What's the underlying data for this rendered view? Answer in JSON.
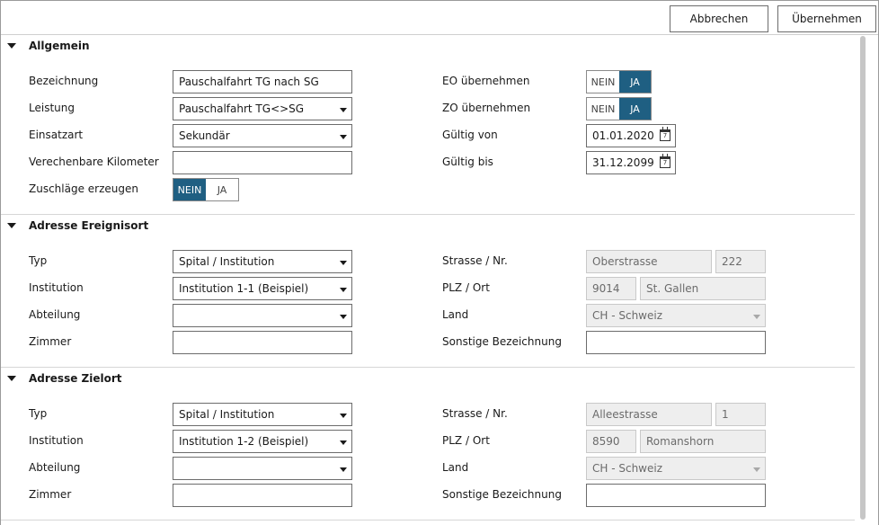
{
  "buttons": {
    "cancel": "Abbrechen",
    "apply": "Übernehmen"
  },
  "sections": {
    "general": {
      "title": "Allgemein",
      "bezeichnung_label": "Bezeichnung",
      "bezeichnung_value": "Pauschalfahrt TG nach SG",
      "leistung_label": "Leistung",
      "leistung_value": "Pauschalfahrt TG<>SG",
      "einsatzart_label": "Einsatzart",
      "einsatzart_value": "Sekundär",
      "km_label": "Verechenbare Kilometer",
      "km_value": "",
      "zuschlaege_label": "Zuschläge erzeugen",
      "zuschlaege_no": "NEIN",
      "zuschlaege_yes": "JA",
      "zuschlaege_selected": "NEIN",
      "eo_label": "EO übernehmen",
      "eo_no": "NEIN",
      "eo_yes": "JA",
      "eo_selected": "JA",
      "zo_label": "ZO übernehmen",
      "zo_no": "NEIN",
      "zo_yes": "JA",
      "zo_selected": "JA",
      "valid_from_label": "Gültig von",
      "valid_from_value": "01.01.2020",
      "valid_to_label": "Gültig bis",
      "valid_to_value": "31.12.2099"
    },
    "origin": {
      "title": "Adresse Ereignisort",
      "typ_label": "Typ",
      "typ_value": "Spital / Institution",
      "institution_label": "Institution",
      "institution_value": "Institution 1-1 (Beispiel)",
      "abteilung_label": "Abteilung",
      "abteilung_value": "",
      "zimmer_label": "Zimmer",
      "zimmer_value": "",
      "street_label": "Strasse / Nr.",
      "street_value": "Oberstrasse",
      "number_value": "222",
      "plz_label": "PLZ / Ort",
      "plz_value": "9014",
      "city_value": "St. Gallen",
      "country_label": "Land",
      "country_value": "CH - Schweiz",
      "other_label": "Sonstige Bezeichnung",
      "other_value": ""
    },
    "destination": {
      "title": "Adresse Zielort",
      "typ_label": "Typ",
      "typ_value": "Spital / Institution",
      "institution_label": "Institution",
      "institution_value": "Institution 1-2 (Beispiel)",
      "abteilung_label": "Abteilung",
      "abteilung_value": "",
      "zimmer_label": "Zimmer",
      "zimmer_value": "",
      "street_label": "Strasse / Nr.",
      "street_value": "Alleestrasse",
      "number_value": "1",
      "plz_label": "PLZ / Ort",
      "plz_value": "8590",
      "city_value": "Romanshorn",
      "country_label": "Land",
      "country_value": "CH - Schweiz",
      "other_label": "Sonstige Bezeichnung",
      "other_value": ""
    }
  },
  "colors": {
    "toggle_active": "#1f5f82"
  }
}
